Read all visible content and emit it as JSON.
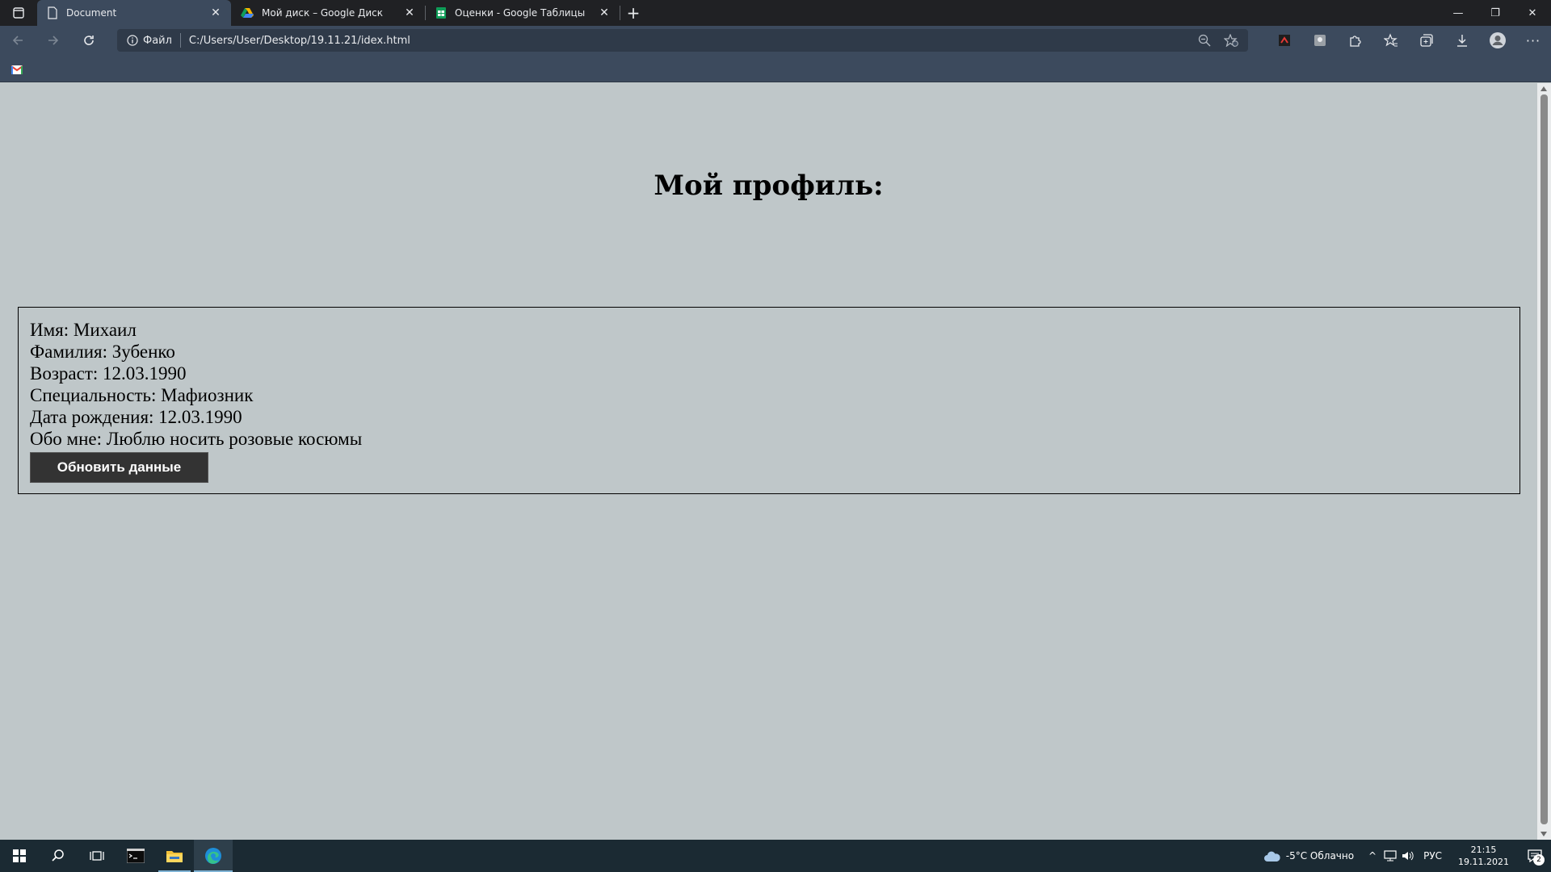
{
  "browser": {
    "tabs": [
      {
        "title": "Document",
        "active": true
      },
      {
        "title": "Мой диск – Google Диск",
        "active": false
      },
      {
        "title": "Оценки - Google Таблицы",
        "active": false
      }
    ],
    "site_info_label": "Файл",
    "url": "C:/Users/User/Desktop/19.11.21/idex.html"
  },
  "page": {
    "title": "Мой профиль:",
    "profile": {
      "name": "Имя: Михаил",
      "surname": "Фамилия: Зубенко",
      "age": "Возраст: 12.03.1990",
      "specialty": "Специальность: Мафиозник",
      "birth_date": "Дата рождения: 12.03.1990",
      "about": "Обо мне: Люблю носить розовые косюмы"
    },
    "update_button": "Обновить данные"
  },
  "taskbar": {
    "weather": "-5°C  Облачно",
    "lang": "РУС",
    "time": "21:15",
    "date": "19.11.2021",
    "notifications": "2"
  },
  "colors": {
    "page_bg": "#bfc7c9",
    "chrome_bg": "#3c4a5d",
    "tabbar_bg": "#202124",
    "button_bg": "#333333",
    "taskbar_bg": "#1b2a33"
  }
}
